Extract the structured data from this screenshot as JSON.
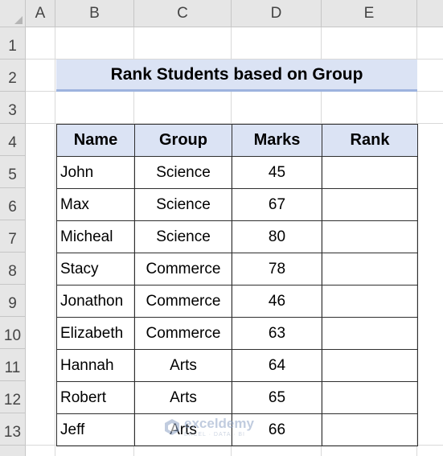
{
  "columns": [
    "A",
    "B",
    "C",
    "D",
    "E"
  ],
  "rows": [
    "1",
    "2",
    "3",
    "4",
    "5",
    "6",
    "7",
    "8",
    "9",
    "10",
    "11",
    "12",
    "13"
  ],
  "title": "Rank Students based on Group",
  "table": {
    "headers": [
      "Name",
      "Group",
      "Marks",
      "Rank"
    ],
    "rows": [
      {
        "name": "John",
        "group": "Science",
        "marks": "45",
        "rank": ""
      },
      {
        "name": "Max",
        "group": "Science",
        "marks": "67",
        "rank": ""
      },
      {
        "name": "Micheal",
        "group": "Science",
        "marks": "80",
        "rank": ""
      },
      {
        "name": "Stacy",
        "group": "Commerce",
        "marks": "78",
        "rank": ""
      },
      {
        "name": "Jonathon",
        "group": "Commerce",
        "marks": "46",
        "rank": ""
      },
      {
        "name": "Elizabeth",
        "group": "Commerce",
        "marks": "63",
        "rank": ""
      },
      {
        "name": "Hannah",
        "group": "Arts",
        "marks": "64",
        "rank": ""
      },
      {
        "name": "Robert",
        "group": "Arts",
        "marks": "65",
        "rank": ""
      },
      {
        "name": "Jeff",
        "group": "Arts",
        "marks": "66",
        "rank": ""
      }
    ]
  },
  "watermark": {
    "main": "exceldemy",
    "sub": "EXCEL · DATA · BI",
    "icon": "exceldemy-logo-icon"
  },
  "colors": {
    "header_fill": "#dbe3f4",
    "title_underline": "#9db3de",
    "gridline": "#d9d9d9",
    "border": "#2f2f2f"
  }
}
